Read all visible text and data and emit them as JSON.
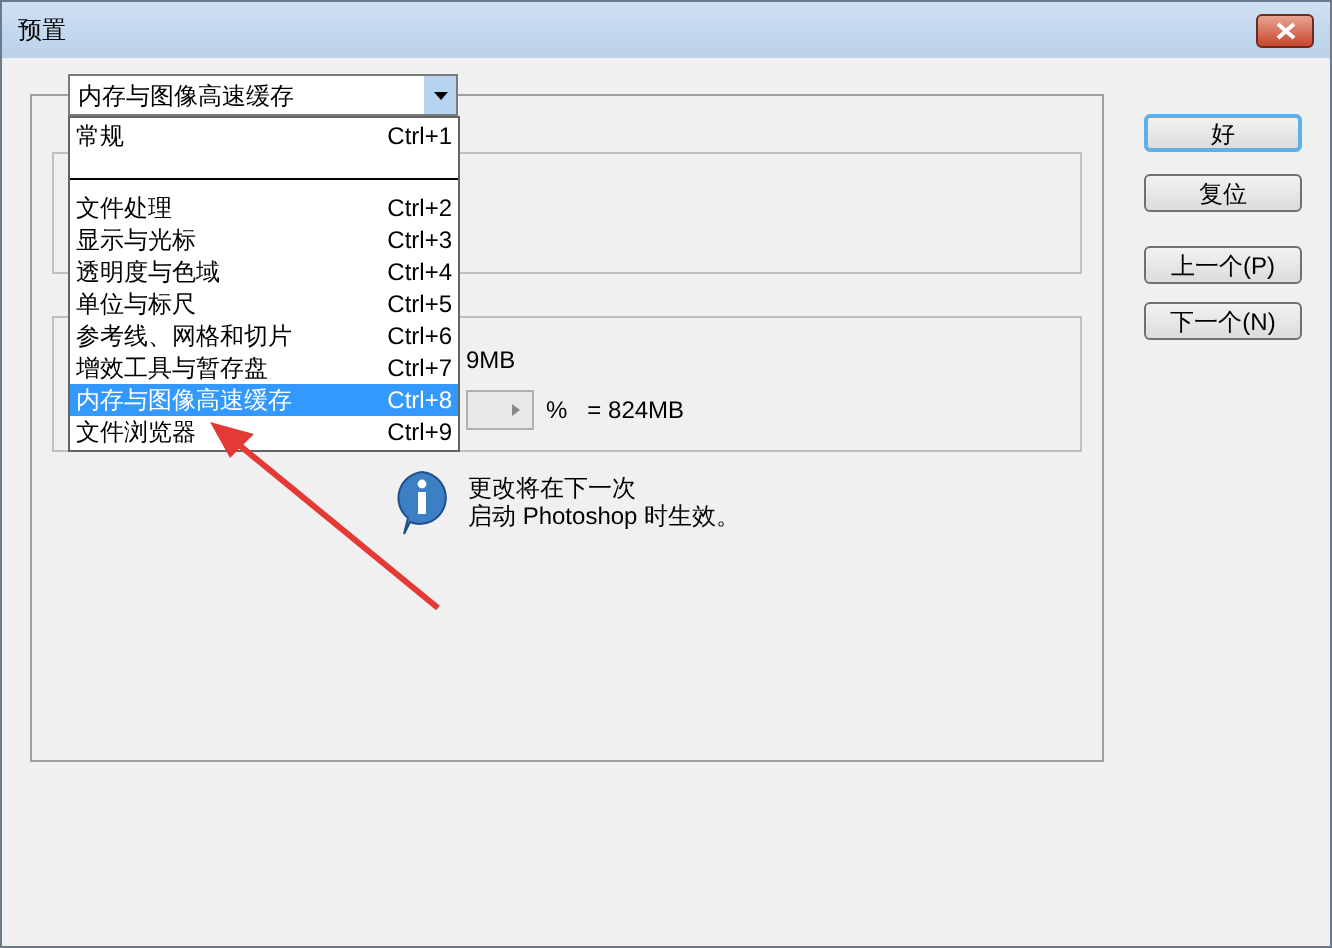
{
  "window": {
    "title": "预置"
  },
  "category_dropdown": {
    "value": "内存与图像高速缓存",
    "expanded": true
  },
  "dropdown_list": [
    {
      "label": "常规",
      "shortcut": "Ctrl+1",
      "selected": false,
      "separator_after": true
    },
    {
      "label": "文件处理",
      "shortcut": "Ctrl+2",
      "selected": false,
      "separator_after": false
    },
    {
      "label": "显示与光标",
      "shortcut": "Ctrl+3",
      "selected": false,
      "separator_after": false
    },
    {
      "label": "透明度与色域",
      "shortcut": "Ctrl+4",
      "selected": false,
      "separator_after": false
    },
    {
      "label": "单位与标尺",
      "shortcut": "Ctrl+5",
      "selected": false,
      "separator_after": false
    },
    {
      "label": "参考线、网格和切片",
      "shortcut": "Ctrl+6",
      "selected": false,
      "separator_after": false
    },
    {
      "label": "增效工具与暂存盘",
      "shortcut": "Ctrl+7",
      "selected": false,
      "separator_after": false
    },
    {
      "label": "内存与图像高速缓存",
      "shortcut": "Ctrl+8",
      "selected": true,
      "separator_after": false
    },
    {
      "label": "文件浏览器",
      "shortcut": "Ctrl+9",
      "selected": false,
      "separator_after": false
    }
  ],
  "memory_group": {
    "available_text": "9MB",
    "percent_label": "%",
    "result": "= 824MB"
  },
  "info": {
    "lines": [
      "更改将在下一次",
      "启动 Photoshop 时生效。"
    ]
  },
  "buttons": [
    {
      "label": "好",
      "default": true
    },
    {
      "label": "复位",
      "default": false
    },
    {
      "label": "上一个(P)",
      "default": false
    },
    {
      "label": "下一个(N)",
      "default": false
    }
  ]
}
